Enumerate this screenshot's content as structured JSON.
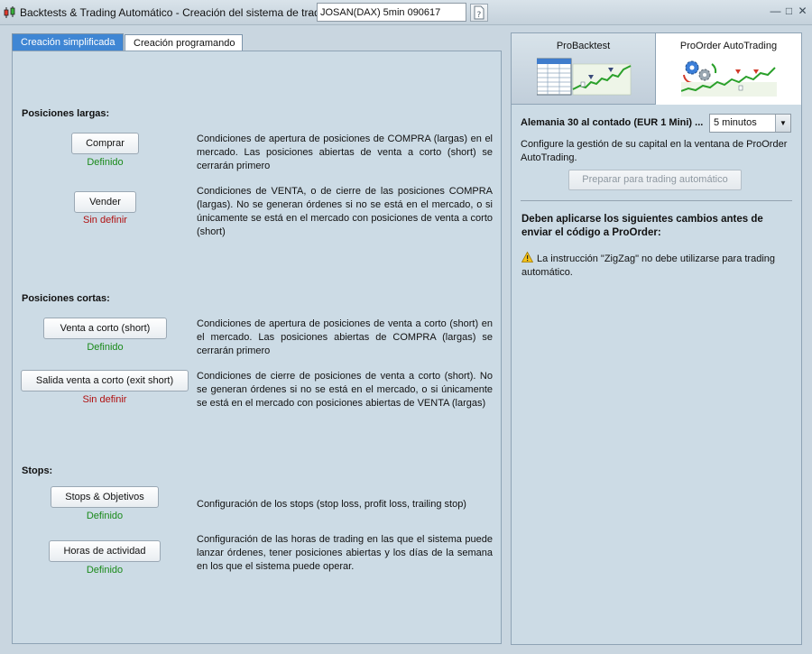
{
  "window": {
    "title": "Backtests & Trading Automático - Creación del sistema de trading",
    "separator": "-",
    "system_name": "JOSAN(DAX) 5min 090617"
  },
  "tabs": [
    {
      "label": "Creación simplificada",
      "active": true
    },
    {
      "label": "Creación programando",
      "active": false
    }
  ],
  "long": {
    "title": "Posiciones largas:",
    "buy": {
      "label": "Comprar",
      "status": "Definido",
      "desc": "Condiciones de apertura de posiciones de COMPRA (largas) en el mercado. Las posiciones abiertas de venta a corto (short) se cerrarán primero"
    },
    "sell": {
      "label": "Vender",
      "status": "Sin definir",
      "desc": "Condiciones de VENTA, o de cierre de las posiciones COMPRA (largas). No se generan órdenes si no se está en el mercado, o si únicamente se está en el mercado con posiciones de venta a corto (short)"
    }
  },
  "short": {
    "title": "Posiciones cortas:",
    "sellshort": {
      "label": "Venta a corto (short)",
      "status": "Definido",
      "desc": "Condiciones de apertura de posiciones de venta a corto (short) en el mercado. Las posiciones abiertas de COMPRA (largas) se cerrarán primero"
    },
    "exitshort": {
      "label": "Salida venta a corto (exit short)",
      "status": "Sin definir",
      "desc": "Condiciones de cierre de posiciones de venta a corto (short). No se generan órdenes si no se está en el mercado, o si únicamente se está en el mercado con posiciones abiertas de VENTA (largas)"
    }
  },
  "stops": {
    "title": "Stops:",
    "targets": {
      "label": "Stops & Objetivos",
      "status": "Definido",
      "desc": "Configuración de los stops (stop loss, profit loss, trailing stop)"
    },
    "hours": {
      "label": "Horas de actividad",
      "status": "Definido",
      "desc": "Configuración de las horas de trading en las que el sistema puede lanzar órdenes, tener posiciones abiertas y los días de la semana en los que el sistema puede operar."
    }
  },
  "right": {
    "tabs": [
      {
        "label": "ProBacktest",
        "icon": "backtest-chart-icon",
        "active": false
      },
      {
        "label": "ProOrder AutoTrading",
        "icon": "autotrading-gears-icon",
        "active": true
      }
    ],
    "market": "Alemania 30 al contado (EUR 1 Mini) ...",
    "timeframe": "5 minutos",
    "capital_text": "Configure la gestión de su capital en la ventana de ProOrder AutoTrading.",
    "prepare_label": "Preparar para trading automático",
    "changes_title": "Deben aplicarse los siguientes cambios antes de enviar el código a ProOrder:",
    "warning": "La instrucción \"ZigZag\" no debe utilizarse para trading automático."
  },
  "colors": {
    "ok": "#1a8a1a",
    "bad": "#b01010",
    "tab_active": "#3f86d4",
    "panel_bg": "#ccdbe5",
    "chart_green": "#2aa02a"
  }
}
